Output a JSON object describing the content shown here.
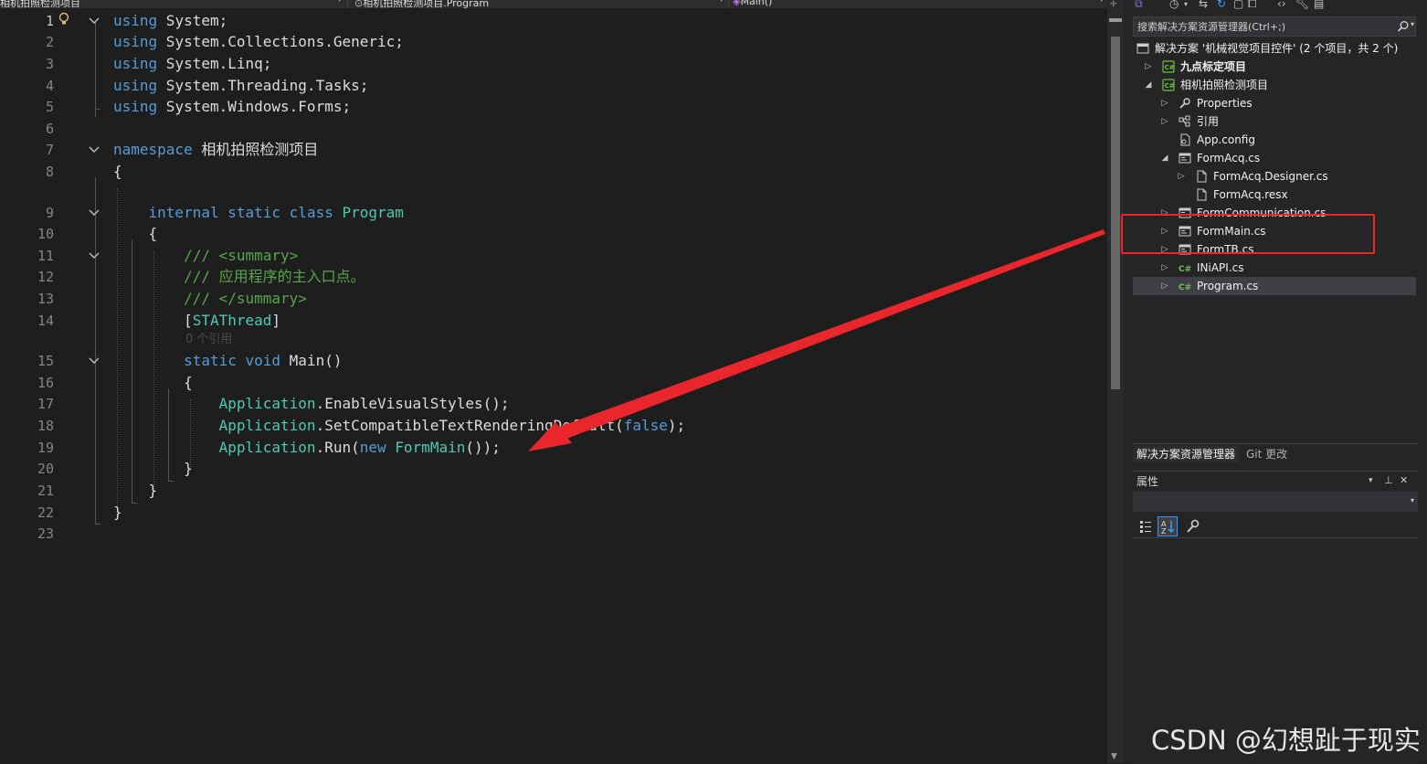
{
  "nav": {
    "project_dd": "相机拍照检测项目",
    "class_dd": "相机拍照检测项目.Program",
    "member_dd": "Main()"
  },
  "editor": {
    "codelens_main": "0 个引用",
    "lines": [
      {
        "n": "1",
        "tokens": [
          {
            "c": "kw",
            "t": "using"
          },
          {
            "c": "pl",
            "t": " System;"
          }
        ]
      },
      {
        "n": "2",
        "tokens": [
          {
            "c": "kw",
            "t": "using"
          },
          {
            "c": "pl",
            "t": " System.Collections.Generic;"
          }
        ]
      },
      {
        "n": "3",
        "tokens": [
          {
            "c": "kw",
            "t": "using"
          },
          {
            "c": "pl",
            "t": " System.Linq;"
          }
        ]
      },
      {
        "n": "4",
        "tokens": [
          {
            "c": "kw",
            "t": "using"
          },
          {
            "c": "pl",
            "t": " System.Threading.Tasks;"
          }
        ]
      },
      {
        "n": "5",
        "tokens": [
          {
            "c": "kw",
            "t": "using"
          },
          {
            "c": "pl",
            "t": " System.Windows.Forms;"
          }
        ]
      },
      {
        "n": "6",
        "tokens": []
      },
      {
        "n": "7",
        "tokens": [
          {
            "c": "kw",
            "t": "namespace"
          },
          {
            "c": "pl",
            "t": " 相机拍照检测项目"
          }
        ]
      },
      {
        "n": "8",
        "tokens": [
          {
            "c": "pl",
            "t": "{"
          }
        ]
      },
      {
        "n": "9",
        "tokens": [
          {
            "c": "pl",
            "t": "    "
          },
          {
            "c": "kw",
            "t": "internal"
          },
          {
            "c": "pl",
            "t": " "
          },
          {
            "c": "kw",
            "t": "static"
          },
          {
            "c": "pl",
            "t": " "
          },
          {
            "c": "kw",
            "t": "class"
          },
          {
            "c": "pl",
            "t": " "
          },
          {
            "c": "ty",
            "t": "Program"
          }
        ]
      },
      {
        "n": "10",
        "tokens": [
          {
            "c": "pl",
            "t": "    {"
          }
        ]
      },
      {
        "n": "11",
        "tokens": [
          {
            "c": "pl",
            "t": "        "
          },
          {
            "c": "cm",
            "t": "/// <summary>"
          }
        ]
      },
      {
        "n": "12",
        "tokens": [
          {
            "c": "pl",
            "t": "        "
          },
          {
            "c": "cm",
            "t": "/// 应用程序的主入口点。"
          }
        ]
      },
      {
        "n": "13",
        "tokens": [
          {
            "c": "pl",
            "t": "        "
          },
          {
            "c": "cm",
            "t": "/// </summary>"
          }
        ]
      },
      {
        "n": "14",
        "tokens": [
          {
            "c": "pl",
            "t": "        ["
          },
          {
            "c": "at",
            "t": "STAThread"
          },
          {
            "c": "pl",
            "t": "]"
          }
        ]
      },
      {
        "n": "15",
        "tokens": [
          {
            "c": "pl",
            "t": "        "
          },
          {
            "c": "kw",
            "t": "static"
          },
          {
            "c": "pl",
            "t": " "
          },
          {
            "c": "kw",
            "t": "void"
          },
          {
            "c": "pl",
            "t": " Main()"
          }
        ]
      },
      {
        "n": "16",
        "tokens": [
          {
            "c": "pl",
            "t": "        {"
          }
        ]
      },
      {
        "n": "17",
        "tokens": [
          {
            "c": "pl",
            "t": "            "
          },
          {
            "c": "ty",
            "t": "Application"
          },
          {
            "c": "pl",
            "t": ".EnableVisualStyles();"
          }
        ]
      },
      {
        "n": "18",
        "tokens": [
          {
            "c": "pl",
            "t": "            "
          },
          {
            "c": "ty",
            "t": "Application"
          },
          {
            "c": "pl",
            "t": ".SetCompatibleTextRenderingDefault("
          },
          {
            "c": "kw",
            "t": "false"
          },
          {
            "c": "pl",
            "t": ");"
          }
        ]
      },
      {
        "n": "19",
        "tokens": [
          {
            "c": "pl",
            "t": "            "
          },
          {
            "c": "ty",
            "t": "Application"
          },
          {
            "c": "pl",
            "t": ".Run("
          },
          {
            "c": "kw",
            "t": "new"
          },
          {
            "c": "pl",
            "t": " "
          },
          {
            "c": "ty",
            "t": "FormMain"
          },
          {
            "c": "pl",
            "t": "());"
          }
        ]
      },
      {
        "n": "20",
        "tokens": [
          {
            "c": "pl",
            "t": "        }"
          }
        ]
      },
      {
        "n": "21",
        "tokens": [
          {
            "c": "pl",
            "t": "    }"
          }
        ]
      },
      {
        "n": "22",
        "tokens": [
          {
            "c": "pl",
            "t": "}"
          }
        ]
      },
      {
        "n": "23",
        "tokens": []
      }
    ]
  },
  "solution_explorer": {
    "search_placeholder": "搜索解决方案资源管理器(Ctrl+;)",
    "tree": [
      {
        "label": "解决方案 '机械视觉项目控件' (2 个项目，共 2 个)",
        "icon": "solution-icon",
        "depth": 0,
        "exp": ""
      },
      {
        "label": "九点标定项目",
        "icon": "csharp-project-icon",
        "depth": 1,
        "exp": "collapsed",
        "bold": true
      },
      {
        "label": "相机拍照检测项目",
        "icon": "csharp-project-icon",
        "depth": 1,
        "exp": "expanded"
      },
      {
        "label": "Properties",
        "icon": "wrench-icon",
        "depth": 2,
        "exp": "collapsed"
      },
      {
        "label": "引用",
        "icon": "references-icon",
        "depth": 2,
        "exp": "collapsed"
      },
      {
        "label": "App.config",
        "icon": "config-icon",
        "depth": 2,
        "exp": ""
      },
      {
        "label": "FormAcq.cs",
        "icon": "form-icon",
        "depth": 2,
        "exp": "expanded"
      },
      {
        "label": "FormAcq.Designer.cs",
        "icon": "file-icon",
        "depth": 3,
        "exp": "collapsed"
      },
      {
        "label": "FormAcq.resx",
        "icon": "file-icon",
        "depth": 3,
        "exp": ""
      },
      {
        "label": "FormCommunication.cs",
        "icon": "form-icon",
        "depth": 2,
        "exp": "collapsed"
      },
      {
        "label": "FormMain.cs",
        "icon": "form-icon",
        "depth": 2,
        "exp": "collapsed"
      },
      {
        "label": "FormTB.cs",
        "icon": "form-icon",
        "depth": 2,
        "exp": "collapsed"
      },
      {
        "label": "INiAPI.cs",
        "icon": "csharp-file-icon",
        "depth": 2,
        "exp": "collapsed"
      },
      {
        "label": "Program.cs",
        "icon": "csharp-file-icon",
        "depth": 2,
        "exp": "collapsed",
        "selected": true
      }
    ],
    "tab_active": "解决方案资源管理器",
    "tab_git": "Git 更改"
  },
  "properties": {
    "title": "属性"
  },
  "watermark": "CSDN @幻想趾于现实",
  "colors": {
    "annotation_red": "#e8262b",
    "keyword": "#569cd6",
    "type": "#4ec9b0",
    "comment": "#57a64a"
  }
}
